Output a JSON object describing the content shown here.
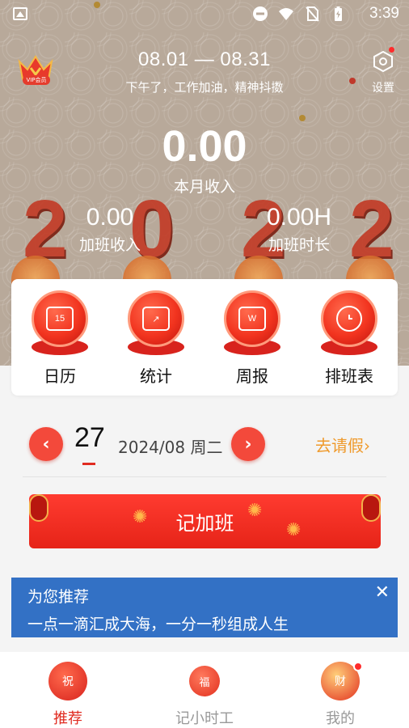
{
  "status_bar": {
    "time": "3:39"
  },
  "header": {
    "vip_label": "VIP会员",
    "date_range": "08.01 — 08.31",
    "subtitle": "下午了，工作加油，精神抖擞",
    "settings_label": "设置"
  },
  "summary": {
    "month_amount": "0.00",
    "month_label": "本月收入",
    "overtime_income_value": "0.00",
    "overtime_income_label": "加班收入",
    "overtime_hours_value": "0.00H",
    "overtime_hours_label": "加班时长"
  },
  "quick_menu": [
    {
      "label": "日历",
      "icon": "calendar-icon",
      "glyph": "15"
    },
    {
      "label": "统计",
      "icon": "chart-icon",
      "glyph": "↗"
    },
    {
      "label": "周报",
      "icon": "weekly-report-icon",
      "glyph": "W"
    },
    {
      "label": "排班表",
      "icon": "clock-icon",
      "glyph": ""
    }
  ],
  "date_selector": {
    "day": "27",
    "year_month_weekday": "2024/08 周二",
    "leave_link": "去请假",
    "prev_icon": "chevron-left-icon",
    "next_icon": "chevron-right-icon"
  },
  "log_overtime": {
    "label": "记加班"
  },
  "recommend": {
    "title": "为您推荐",
    "text": "一点一滴汇成大海，一分一秒组成人生",
    "close": "✕"
  },
  "bottom_nav": [
    {
      "label": "推荐",
      "icon": "recommend-icon",
      "badge": "祝",
      "active": true
    },
    {
      "label": "记小时工",
      "icon": "hourly-work-icon",
      "badge": "福",
      "active": false
    },
    {
      "label": "我的",
      "icon": "profile-icon",
      "badge": "财",
      "active": false
    }
  ],
  "colors": {
    "primary_red": "#f3493b",
    "leave_orange": "#ef9a2c",
    "banner_blue": "#3371c5",
    "nav_active": "#e02b20",
    "nav_inactive": "#999999"
  }
}
